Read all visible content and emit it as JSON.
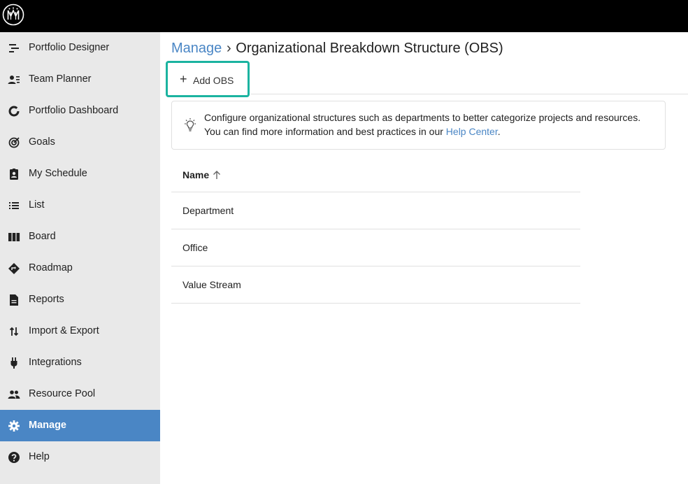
{
  "app": {
    "logo_icon": "mm-logo-icon",
    "accent_color": "#4a86c5",
    "highlight_color": "#1bb3a0"
  },
  "sidebar": {
    "items": [
      {
        "label": "Portfolio Designer",
        "icon": "portfolio-designer-icon"
      },
      {
        "label": "Team Planner",
        "icon": "team-planner-icon"
      },
      {
        "label": "Portfolio Dashboard",
        "icon": "dashboard-icon"
      },
      {
        "label": "Goals",
        "icon": "goals-icon"
      },
      {
        "label": "My Schedule",
        "icon": "schedule-icon"
      },
      {
        "label": "List",
        "icon": "list-icon"
      },
      {
        "label": "Board",
        "icon": "board-icon"
      },
      {
        "label": "Roadmap",
        "icon": "roadmap-icon"
      },
      {
        "label": "Reports",
        "icon": "reports-icon"
      },
      {
        "label": "Import & Export",
        "icon": "import-export-icon"
      },
      {
        "label": "Integrations",
        "icon": "integrations-icon"
      },
      {
        "label": "Resource Pool",
        "icon": "resource-pool-icon"
      },
      {
        "label": "Manage",
        "icon": "gear-icon",
        "active": true
      },
      {
        "label": "Help",
        "icon": "help-icon"
      }
    ]
  },
  "header": {
    "breadcrumb_link": "Manage",
    "breadcrumb_separator": "›",
    "title": "Organizational Breakdown Structure (OBS)"
  },
  "toolbar": {
    "add_label": "Add OBS",
    "add_icon": "plus-icon"
  },
  "info": {
    "icon": "lightbulb-icon",
    "line1": "Configure organizational structures such as departments to better categorize projects and resources.",
    "line2_prefix": "You can find more information and best practices in our ",
    "link": "Help Center",
    "line2_suffix": "."
  },
  "table": {
    "header": "Name",
    "sort_icon": "arrow-up-icon",
    "rows": [
      "Department",
      "Office",
      "Value Stream"
    ]
  }
}
